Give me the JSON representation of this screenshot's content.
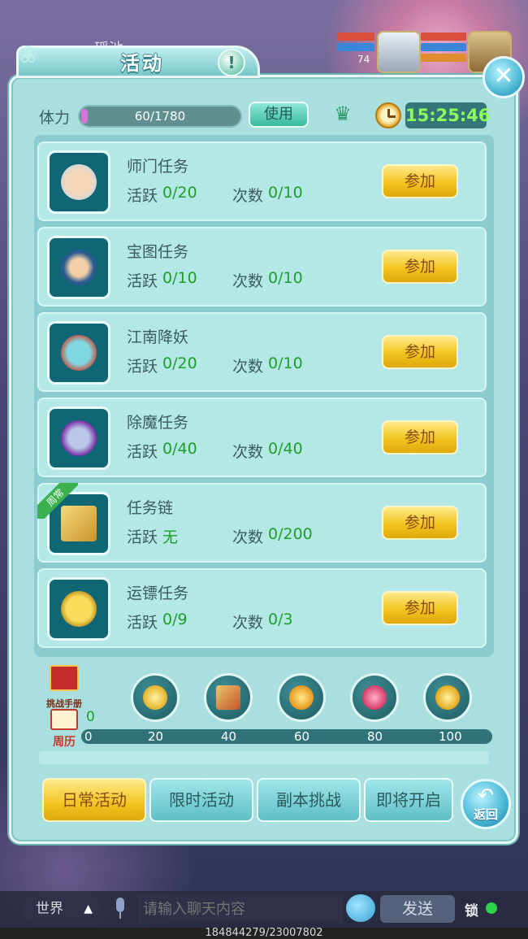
{
  "hud": {
    "player_name": "瑶池",
    "level": "74"
  },
  "panel": {
    "title": "活动",
    "stamina": {
      "label": "体力",
      "value": "60/1780",
      "fraction": 0.034
    },
    "use_label": "使用",
    "time": "15:25:46"
  },
  "activities": [
    {
      "name": "师门任务",
      "active_label": "活跃",
      "active_value": "0/20",
      "count_label": "次数",
      "count_value": "0/10",
      "button": "参加",
      "icon": "old-master-icon"
    },
    {
      "name": "宝图任务",
      "active_label": "活跃",
      "active_value": "0/10",
      "count_label": "次数",
      "count_value": "0/10",
      "button": "参加",
      "icon": "ninja-icon"
    },
    {
      "name": "江南降妖",
      "active_label": "活跃",
      "active_value": "0/20",
      "count_label": "次数",
      "count_value": "0/10",
      "button": "参加",
      "icon": "goblin-icon"
    },
    {
      "name": "除魔任务",
      "active_label": "活跃",
      "active_value": "0/40",
      "count_label": "次数",
      "count_value": "0/40",
      "button": "参加",
      "icon": "jiangshi-icon"
    },
    {
      "name": "任务链",
      "active_label": "活跃",
      "active_value": "无",
      "count_label": "次数",
      "count_value": "0/200",
      "button": "参加",
      "icon": "book-icon",
      "tag": "周常"
    },
    {
      "name": "运镖任务",
      "active_label": "活跃",
      "active_value": "0/9",
      "count_label": "次数",
      "count_value": "0/3",
      "button": "参加",
      "icon": "escort-coin-icon"
    }
  ],
  "progress": {
    "handbook_label": "挑战手册",
    "calendar_label": "周历",
    "points": "0",
    "ticks": [
      "0",
      "20",
      "40",
      "60",
      "80",
      "100"
    ],
    "rewards": [
      "peach-icon",
      "scroll-icon",
      "star-gem-icon",
      "pink-orb-icon",
      "gold-coin-icon"
    ]
  },
  "tabs": [
    "日常活动",
    "限时活动",
    "副本挑战",
    "即将开启"
  ],
  "back_label": "返回",
  "chat": {
    "channel": "世界",
    "placeholder": "请输入聊天内容",
    "send": "发送",
    "lock": "锁",
    "footer": "184844279/23007802"
  },
  "colors": {
    "accent_green": "#1f9e2a",
    "button_gold": "#f2c420",
    "panel_teal": "#aadfe0"
  }
}
